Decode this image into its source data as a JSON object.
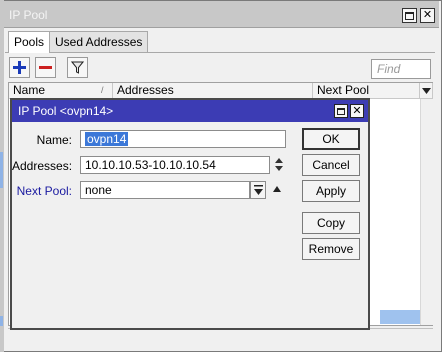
{
  "outer_window": {
    "title": "IP Pool",
    "tabs": [
      "Pools",
      "Used Addresses"
    ],
    "find_placeholder": "Find",
    "columns": [
      "Name",
      "Addresses",
      "Next Pool"
    ]
  },
  "dialog": {
    "title": "IP Pool <ovpn14>",
    "fields": {
      "name_label": "Name:",
      "name_value": "ovpn14",
      "addresses_label": "Addresses:",
      "addresses_value": "10.10.10.53-10.10.10.54",
      "next_pool_label": "Next Pool:",
      "next_pool_value": "none"
    },
    "buttons": {
      "ok": "OK",
      "cancel": "Cancel",
      "apply": "Apply",
      "copy": "Copy",
      "remove": "Remove"
    }
  },
  "colors": {
    "dialog_title_bg": "#3c3cb4",
    "selection": "#3c78d8",
    "add_icon": "#1a3ab8",
    "remove_icon": "#cc2020",
    "next_pool_label": "#1a1aa0"
  },
  "icons": [
    "add-icon",
    "remove-icon",
    "filter-icon",
    "restore-icon",
    "close-icon",
    "sort-icon",
    "column-menu-icon",
    "spinner-icon",
    "dropdown-icon",
    "collapse-icon"
  ]
}
